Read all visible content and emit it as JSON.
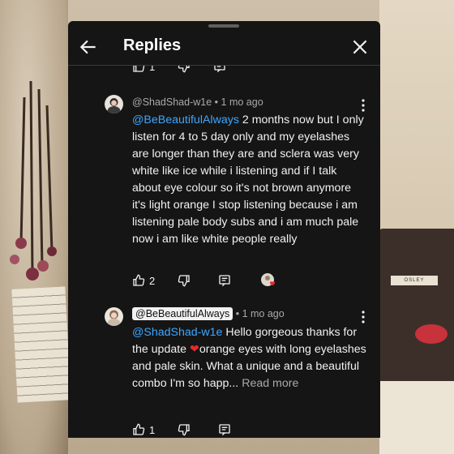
{
  "header": {
    "title": "Replies"
  },
  "top_actions": {
    "like_count": "1"
  },
  "replies": [
    {
      "author": "@ShadShad-w1e",
      "separator": "•",
      "time": "1 mo ago",
      "mention": "@BeBeautifulAlways",
      "text": " 2 months now but I only listen for 4 to 5 day only and my eyelashes are longer than they are and sclera was very white like ice while i listening and if I talk about eye colour so it's not brown anymore it's light orange I stop listening because i am listening pale body subs and i am much pale now i am like white people really",
      "like_count": "2"
    },
    {
      "author": "@BeBeautifulAlways",
      "separator": "•",
      "time": "1 mo ago",
      "mention": "@ShadShad-w1e",
      "text_before_heart": " Hello gorgeous thanks for the update ",
      "heart": "❤",
      "text_after_heart": "orange eyes with long eyelashes and pale skin. What a unique and a beautiful combo I'm so happ...",
      "read_more": " Read more",
      "like_count": "1"
    }
  ],
  "background": {
    "record_label": "OSLEY"
  },
  "icons": {
    "back": "arrow-left-icon",
    "close": "close-icon",
    "like": "thumbs-up-icon",
    "dislike": "thumbs-down-icon",
    "reply": "reply-icon",
    "more": "more-vertical-icon",
    "creator_heart": "creator-heart-icon"
  },
  "colors": {
    "panel_bg": "#151515",
    "mention": "#3ea6ff",
    "heart": "#e22b2b",
    "meta": "#aaaaaa"
  }
}
